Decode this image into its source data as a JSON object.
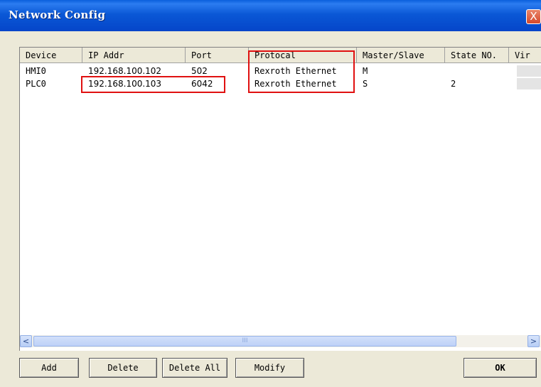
{
  "window": {
    "title": "Network Config",
    "close_label": "X"
  },
  "table": {
    "columns": [
      "Device",
      "IP Addr",
      "Port",
      "Protocal",
      "Master/Slave",
      "State NO.",
      "Vir"
    ],
    "rows": [
      [
        "HMI0",
        "192.168.100.102",
        "502",
        "Rexroth Ethernet",
        "M",
        ""
      ],
      [
        "PLC0",
        "192.168.100.103",
        "6042",
        "Rexroth Ethernet",
        "S",
        "2"
      ]
    ]
  },
  "scrollbar": {
    "left_arrow": "<",
    "right_arrow": ">",
    "grip": "III"
  },
  "buttons": {
    "add": "Add",
    "delete": "Delete",
    "delete_all": "Delete All",
    "modify": "Modify",
    "ok": "OK"
  },
  "colors": {
    "highlight": "#e01010",
    "titlebar": "#0a58d6"
  }
}
